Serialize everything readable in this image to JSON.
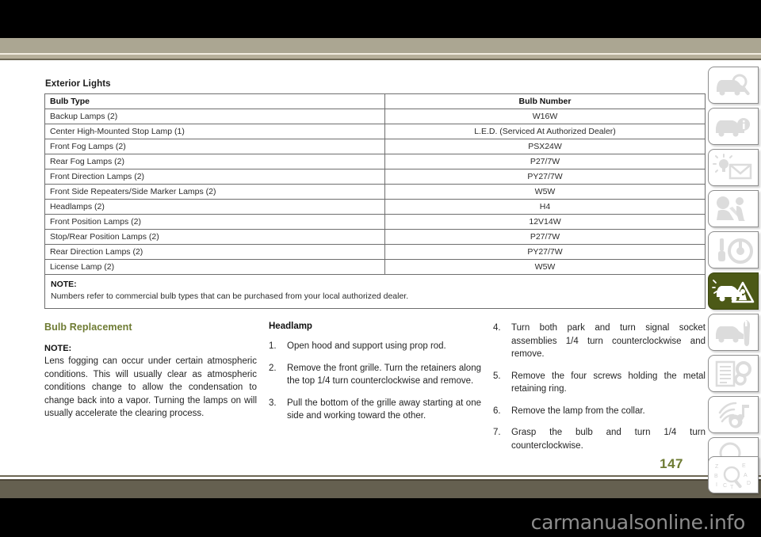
{
  "page": {
    "number": "147",
    "watermark": "carmanualsonline.info"
  },
  "section": {
    "title": "Exterior Lights"
  },
  "table": {
    "headers": [
      "Bulb Type",
      "Bulb Number"
    ],
    "rows": [
      [
        "Backup Lamps (2)",
        "W16W"
      ],
      [
        "Center High-Mounted Stop Lamp (1)",
        "L.E.D. (Serviced At Authorized Dealer)"
      ],
      [
        "Front Fog Lamps (2)",
        "PSX24W"
      ],
      [
        "Rear Fog Lamps (2)",
        "P27/7W"
      ],
      [
        "Front Direction Lamps (2)",
        "PY27/7W"
      ],
      [
        "Front Side Repeaters/Side Marker Lamps (2)",
        "W5W"
      ],
      [
        "Headlamps (2)",
        "H4"
      ],
      [
        "Front Position Lamps (2)",
        "12V14W"
      ],
      [
        "Stop/Rear Position Lamps (2)",
        "P27/7W"
      ],
      [
        "Rear Direction Lamps (2)",
        "PY27/7W"
      ],
      [
        "License Lamp (2)",
        "W5W"
      ]
    ],
    "note_label": "NOTE:",
    "note_text": "Numbers refer to commercial bulb types that can be purchased from your local authorized dealer."
  },
  "bulb_replacement": {
    "heading": "Bulb Replacement",
    "note_label": "NOTE:",
    "note_text": "Lens fogging can occur under certain atmospheric conditions. This will usually clear as atmospheric conditions change to allow the condensation to change back into a vapor. Turning the lamps on will usually accelerate the clearing process."
  },
  "headlamp": {
    "heading": "Headlamp",
    "steps": [
      {
        "num": "1.",
        "text": "Open hood and support using prop rod."
      },
      {
        "num": "2.",
        "text": "Remove the front grille. Turn the retainers along the top 1/4 turn counterclockwise and remove."
      },
      {
        "num": "3.",
        "text": "Pull the bottom of the grille away starting at one side and working toward the other."
      },
      {
        "num": "4.",
        "text": "Turn both park and turn signal socket assemblies 1/4 turn counterclockwise and remove."
      },
      {
        "num": "5.",
        "text": "Remove the four screws holding the metal retaining ring."
      },
      {
        "num": "6.",
        "text": "Remove the lamp from the collar."
      },
      {
        "num": "7.",
        "text": "Grasp the bulb and turn 1/4 turn counterclockwise."
      }
    ]
  },
  "sidebar": {
    "tabs": [
      {
        "icon": "car-magnifier-icon",
        "active": false
      },
      {
        "icon": "car-info-icon",
        "active": false
      },
      {
        "icon": "dashboard-warning-mail-icon",
        "active": false
      },
      {
        "icon": "seatbelt-occupant-icon",
        "active": false
      },
      {
        "icon": "key-steering-wheel-icon",
        "active": false
      },
      {
        "icon": "car-warning-triangle-icon",
        "active": true
      },
      {
        "icon": "car-wrench-icon",
        "active": false
      },
      {
        "icon": "document-gears-icon",
        "active": false
      },
      {
        "icon": "radio-music-icon",
        "active": false
      },
      {
        "icon": "magnifier-icon",
        "active": false
      },
      {
        "icon": "index-letters-magnifier-icon",
        "active": false
      }
    ]
  },
  "colors": {
    "accent_green": "#6e7b33",
    "tab_active_green": "#4c5916",
    "band_tan": "#aba692",
    "band_olive": "#656050"
  }
}
